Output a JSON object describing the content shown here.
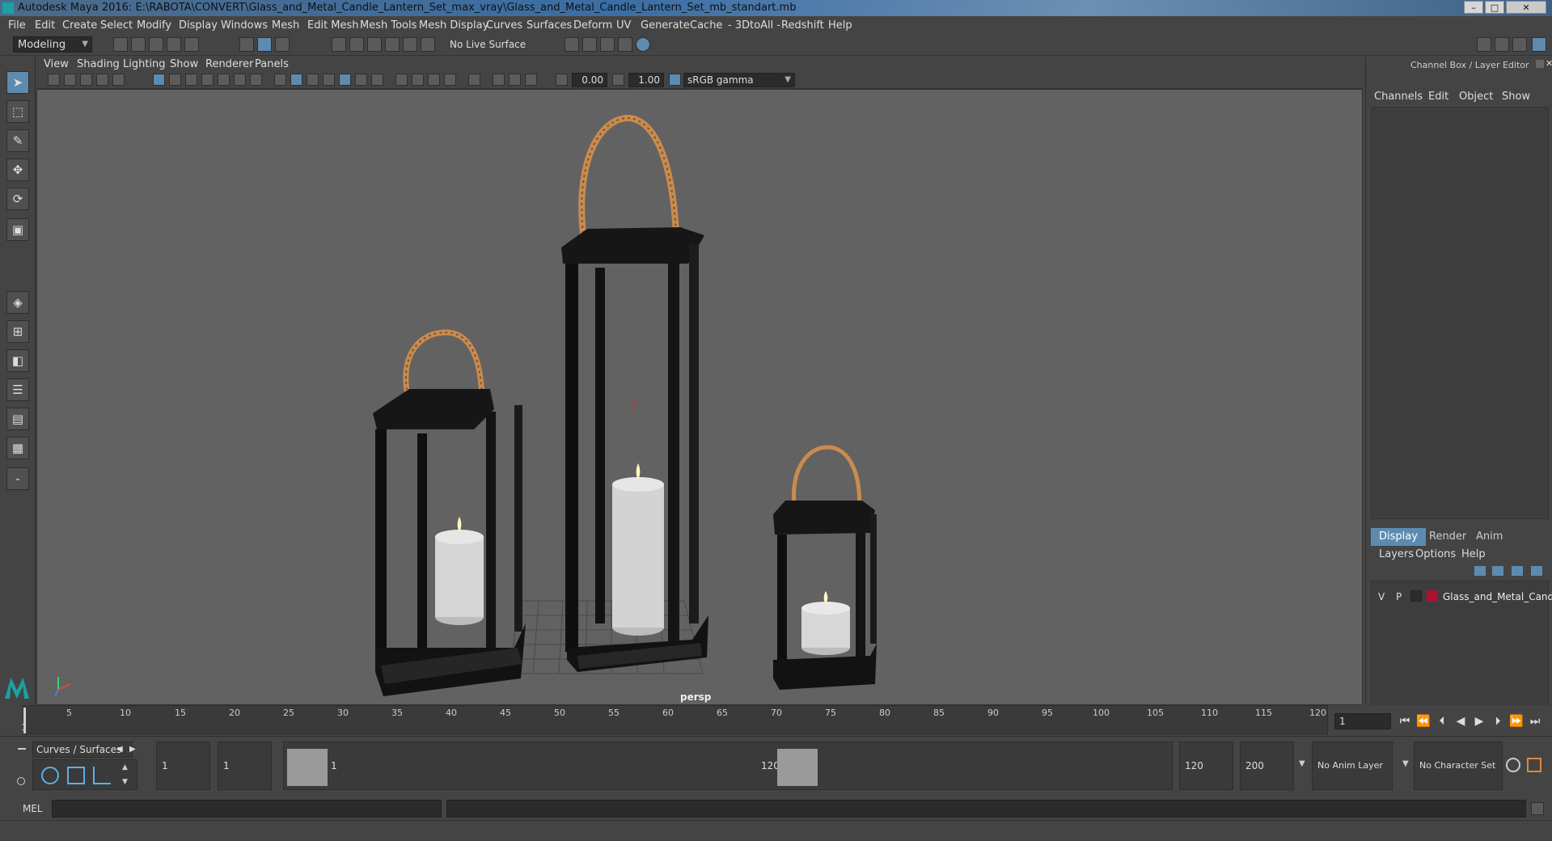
{
  "window": {
    "title": "Autodesk Maya 2016: E:\\RABOTA\\CONVERT\\Glass_and_Metal_Candle_Lantern_Set_max_vray\\Glass_and_Metal_Candle_Lantern_Set_mb_standart.mb",
    "minimize_label": "–",
    "maximize_label": "□",
    "close_label": "✕"
  },
  "menubar": [
    "File",
    "Edit",
    "Create",
    "Select",
    "Modify",
    "Display",
    "Windows",
    "Mesh",
    "Edit Mesh",
    "Mesh Tools",
    "Mesh Display",
    "Curves",
    "Surfaces",
    "Deform",
    "UV",
    "Generate",
    "Cache",
    "- 3DtoAll -",
    "Redshift",
    "Help"
  ],
  "statusline": {
    "mode": "Modeling",
    "live_surface": "No Live Surface"
  },
  "panel": {
    "menu": [
      "View",
      "Shading",
      "Lighting",
      "Show",
      "Renderer",
      "Panels"
    ],
    "exposure": "0.00",
    "gamma": "1.00",
    "color_space": "sRGB gamma",
    "camera_label": "persp"
  },
  "channel_box": {
    "title": "Channel Box / Layer Editor",
    "menu": [
      "Channels",
      "Edit",
      "Object",
      "Show"
    ],
    "tabs": [
      "Display",
      "Render",
      "Anim"
    ],
    "layer_menu": [
      "Layers",
      "Options",
      "Help"
    ],
    "layer": {
      "v": "V",
      "p": "P",
      "name": "Glass_and_Metal_Candle",
      "color": "#b01030"
    }
  },
  "timeline": {
    "tick_labels": [
      "1",
      "5",
      "10",
      "15",
      "20",
      "25",
      "30",
      "35",
      "40",
      "45",
      "50",
      "55",
      "60",
      "65",
      "70",
      "75",
      "80",
      "85",
      "90",
      "95",
      "100",
      "105",
      "110",
      "115",
      "120"
    ],
    "current_frame": "1"
  },
  "range": {
    "shelf_tab": "Curves / Surfaces",
    "start": "1",
    "playback_start": "1",
    "range_start_label": "1",
    "range_end_label": "120",
    "playback_end": "120",
    "end": "200",
    "anim_layer": "No Anim Layer",
    "character_set": "No Character Set"
  },
  "command": {
    "lang": "MEL"
  },
  "colors": {
    "accent": "#5d8bb0",
    "viewport_bg": "#626262",
    "handle": "#c98b4f"
  }
}
